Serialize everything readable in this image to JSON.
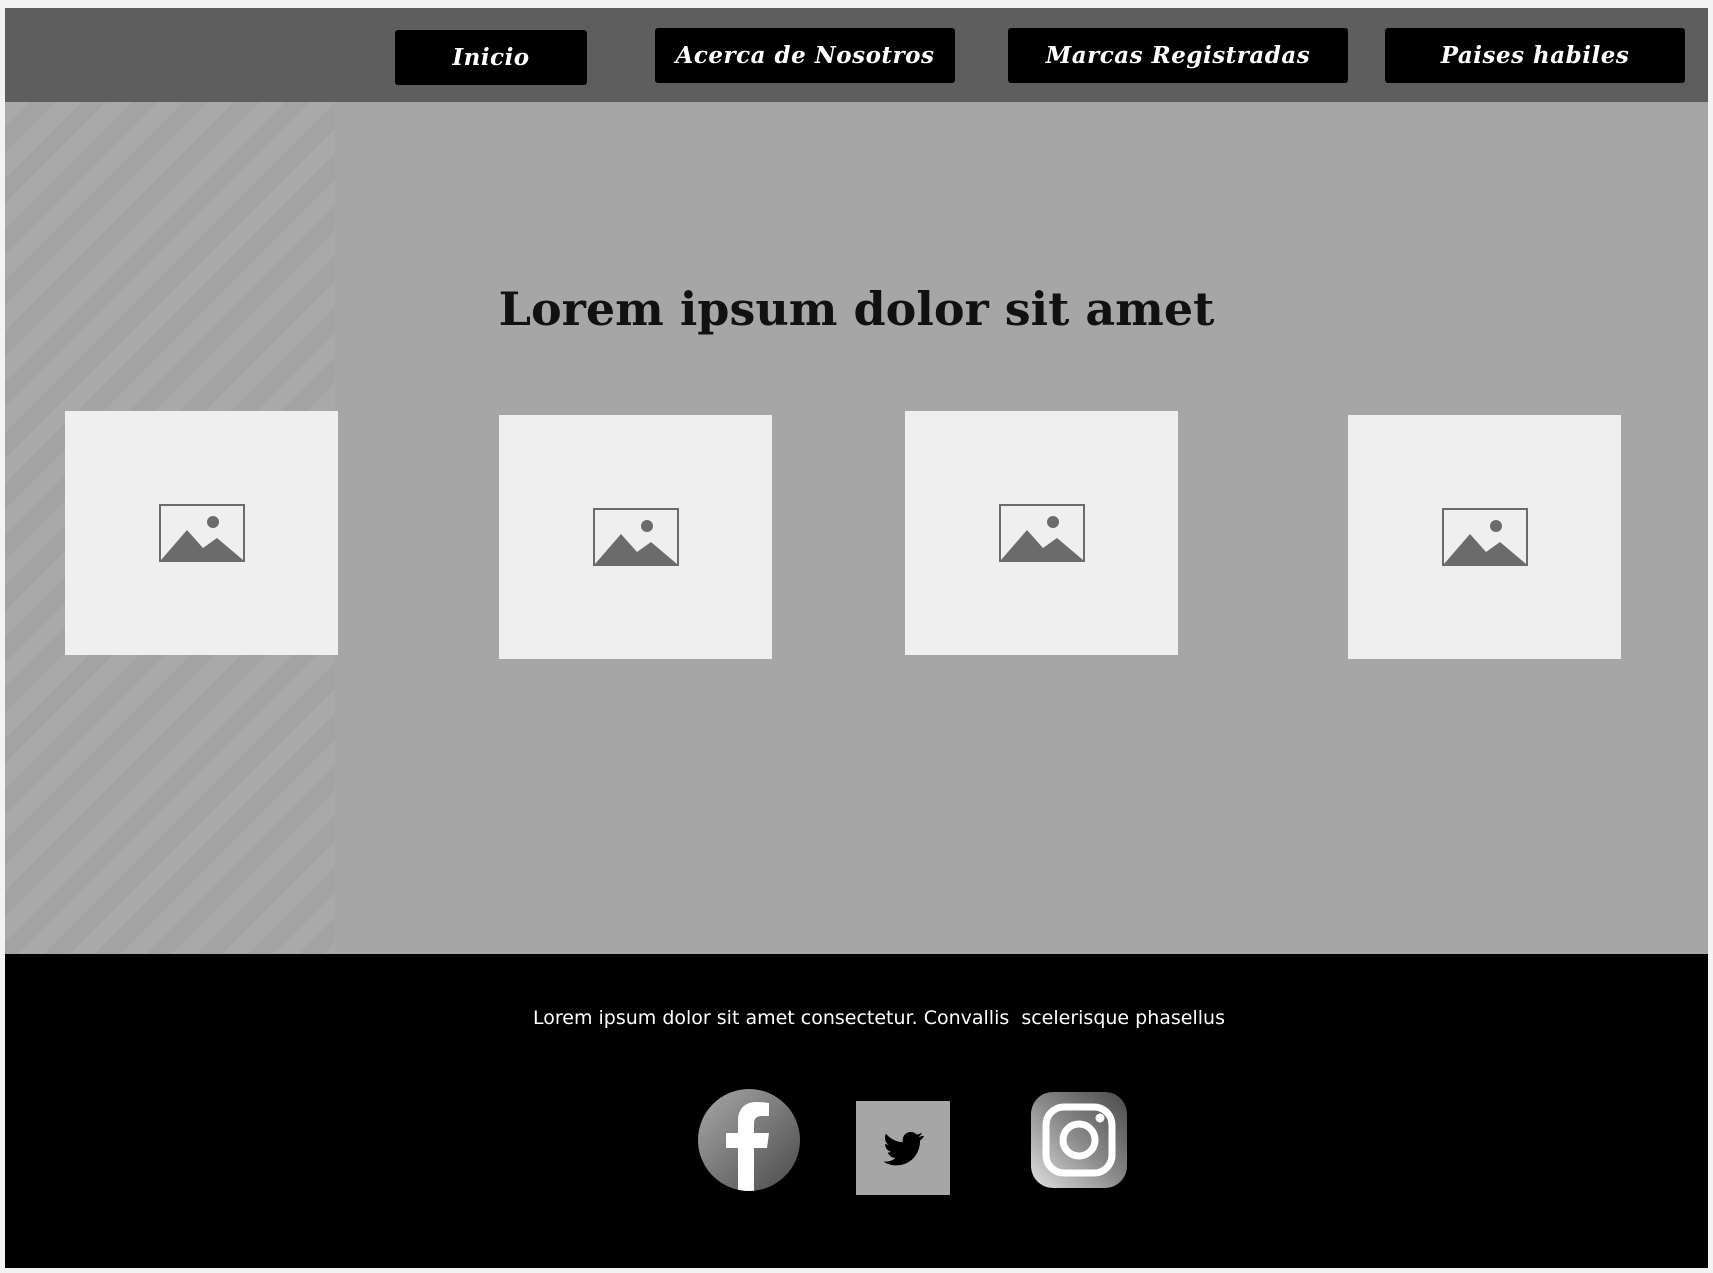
{
  "nav": {
    "items": [
      {
        "label": "Inicio"
      },
      {
        "label": "Acerca de Nosotros"
      },
      {
        "label": "Marcas Registradas"
      },
      {
        "label": "Paises habiles"
      }
    ]
  },
  "hero": {
    "title": "Lorem ipsum dolor sit amet",
    "images": [
      {
        "icon": "image-placeholder-icon"
      },
      {
        "icon": "image-placeholder-icon"
      },
      {
        "icon": "image-placeholder-icon"
      },
      {
        "icon": "image-placeholder-icon"
      }
    ]
  },
  "footer": {
    "text": "Lorem ipsum dolor sit amet consectetur. Convallis  scelerisque phasellus",
    "social": [
      {
        "icon": "facebook-icon"
      },
      {
        "icon": "twitter-icon"
      },
      {
        "icon": "instagram-icon"
      }
    ]
  },
  "colors": {
    "topbar": "#5e5e5e",
    "hero_bg": "#a6a6a6",
    "button_bg": "#000000",
    "card_bg": "#efefef",
    "footer_bg": "#000000"
  }
}
